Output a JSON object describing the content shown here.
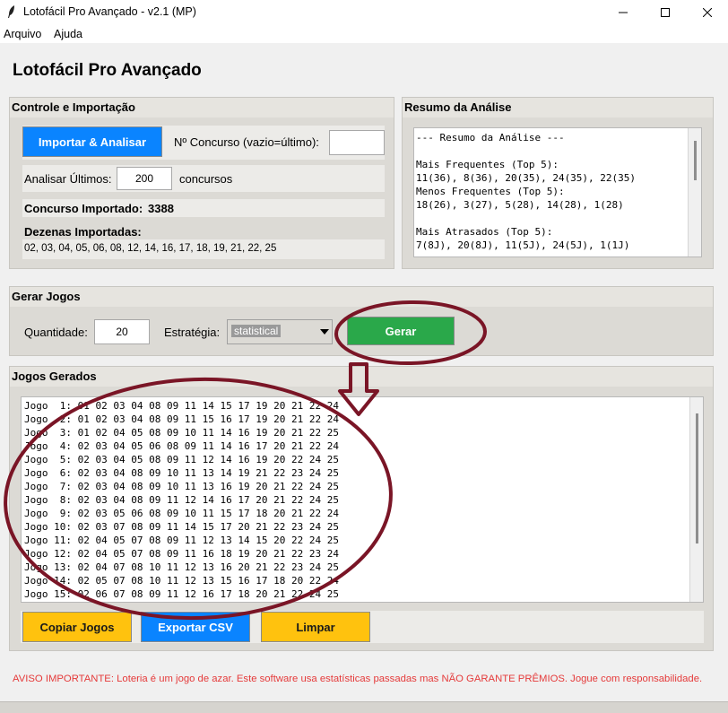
{
  "window": {
    "title": "Lotofácil Pro Avançado - v2.1 (MP)",
    "minimize_glyph": "—",
    "maximize_glyph": "☐",
    "close_glyph": "✕"
  },
  "menu": [
    "Arquivo",
    "Ajuda"
  ],
  "app_title": "Lotofácil Pro Avançado",
  "controle": {
    "title": "Controle e Importação",
    "import_button": "Importar & Analisar",
    "concurso_label": "Nº Concurso (vazio=último):",
    "concurso_value": "",
    "analisar_label": "Analisar Últimos:",
    "analisar_value": "200",
    "analisar_unit": "concursos",
    "importado_label": "Concurso Importado:",
    "importado_value": "3388",
    "dezenas_label": "Dezenas Importadas:",
    "dezenas_value": "02, 03, 04, 05, 06, 08, 12, 14, 16, 17, 18, 19, 21, 22, 25"
  },
  "resumo": {
    "title": "Resumo da Análise",
    "lines": [
      "--- Resumo da Análise ---",
      "",
      "Mais Frequentes (Top 5):",
      "11(36), 8(36), 20(35), 24(35), 22(35)",
      "Menos Frequentes (Top 5):",
      "18(26), 3(27), 5(28), 14(28), 1(28)",
      "",
      "Mais Atrasados (Top 5):",
      "7(8J), 20(8J), 11(5J), 24(5J), 1(1J)"
    ]
  },
  "gerar": {
    "title": "Gerar Jogos",
    "quantidade_label": "Quantidade:",
    "quantidade_value": "20",
    "estrategia_label": "Estratégia:",
    "estrategia_value": "statistical",
    "gerar_button": "Gerar"
  },
  "jogos": {
    "title": "Jogos Gerados",
    "lines": [
      "Jogo  1: 01 02 03 04 08 09 11 14 15 17 19 20 21 22 24",
      "Jogo  2: 01 02 03 04 08 09 11 15 16 17 19 20 21 22 24",
      "Jogo  3: 01 02 04 05 08 09 10 11 14 16 19 20 21 22 25",
      "Jogo  4: 02 03 04 05 06 08 09 11 14 16 17 20 21 22 24",
      "Jogo  5: 02 03 04 05 08 09 11 12 14 16 19 20 22 24 25",
      "Jogo  6: 02 03 04 08 09 10 11 13 14 19 21 22 23 24 25",
      "Jogo  7: 02 03 04 08 09 10 11 13 16 19 20 21 22 24 25",
      "Jogo  8: 02 03 04 08 09 11 12 14 16 17 20 21 22 24 25",
      "Jogo  9: 02 03 05 06 08 09 10 11 15 17 18 20 21 22 24",
      "Jogo 10: 02 03 07 08 09 11 14 15 17 20 21 22 23 24 25",
      "Jogo 11: 02 04 05 07 08 09 11 12 13 14 15 20 22 24 25",
      "Jogo 12: 02 04 05 07 08 09 11 16 18 19 20 21 22 23 24",
      "Jogo 13: 02 04 07 08 10 11 12 13 16 20 21 22 23 24 25",
      "Jogo 14: 02 05 07 08 10 11 12 13 15 16 17 18 20 22 24",
      "Jogo 15: 02 06 07 08 09 11 12 16 17 18 20 21 22 24 25"
    ],
    "copiar_button": "Copiar Jogos",
    "exportar_button": "Exportar CSV",
    "limpar_button": "Limpar"
  },
  "aviso": "AVISO IMPORTANTE: Loteria é um jogo de azar. Este software usa estatísticas passadas mas NÃO GARANTE PRÊMIOS. Jogue com responsabilidade.",
  "colors": {
    "annotation": "#7a1526",
    "blue_button": "#0a84ff",
    "green_button": "#2aa84a",
    "yellow_button": "#ffc20e",
    "warning_text": "#e53a3a"
  }
}
